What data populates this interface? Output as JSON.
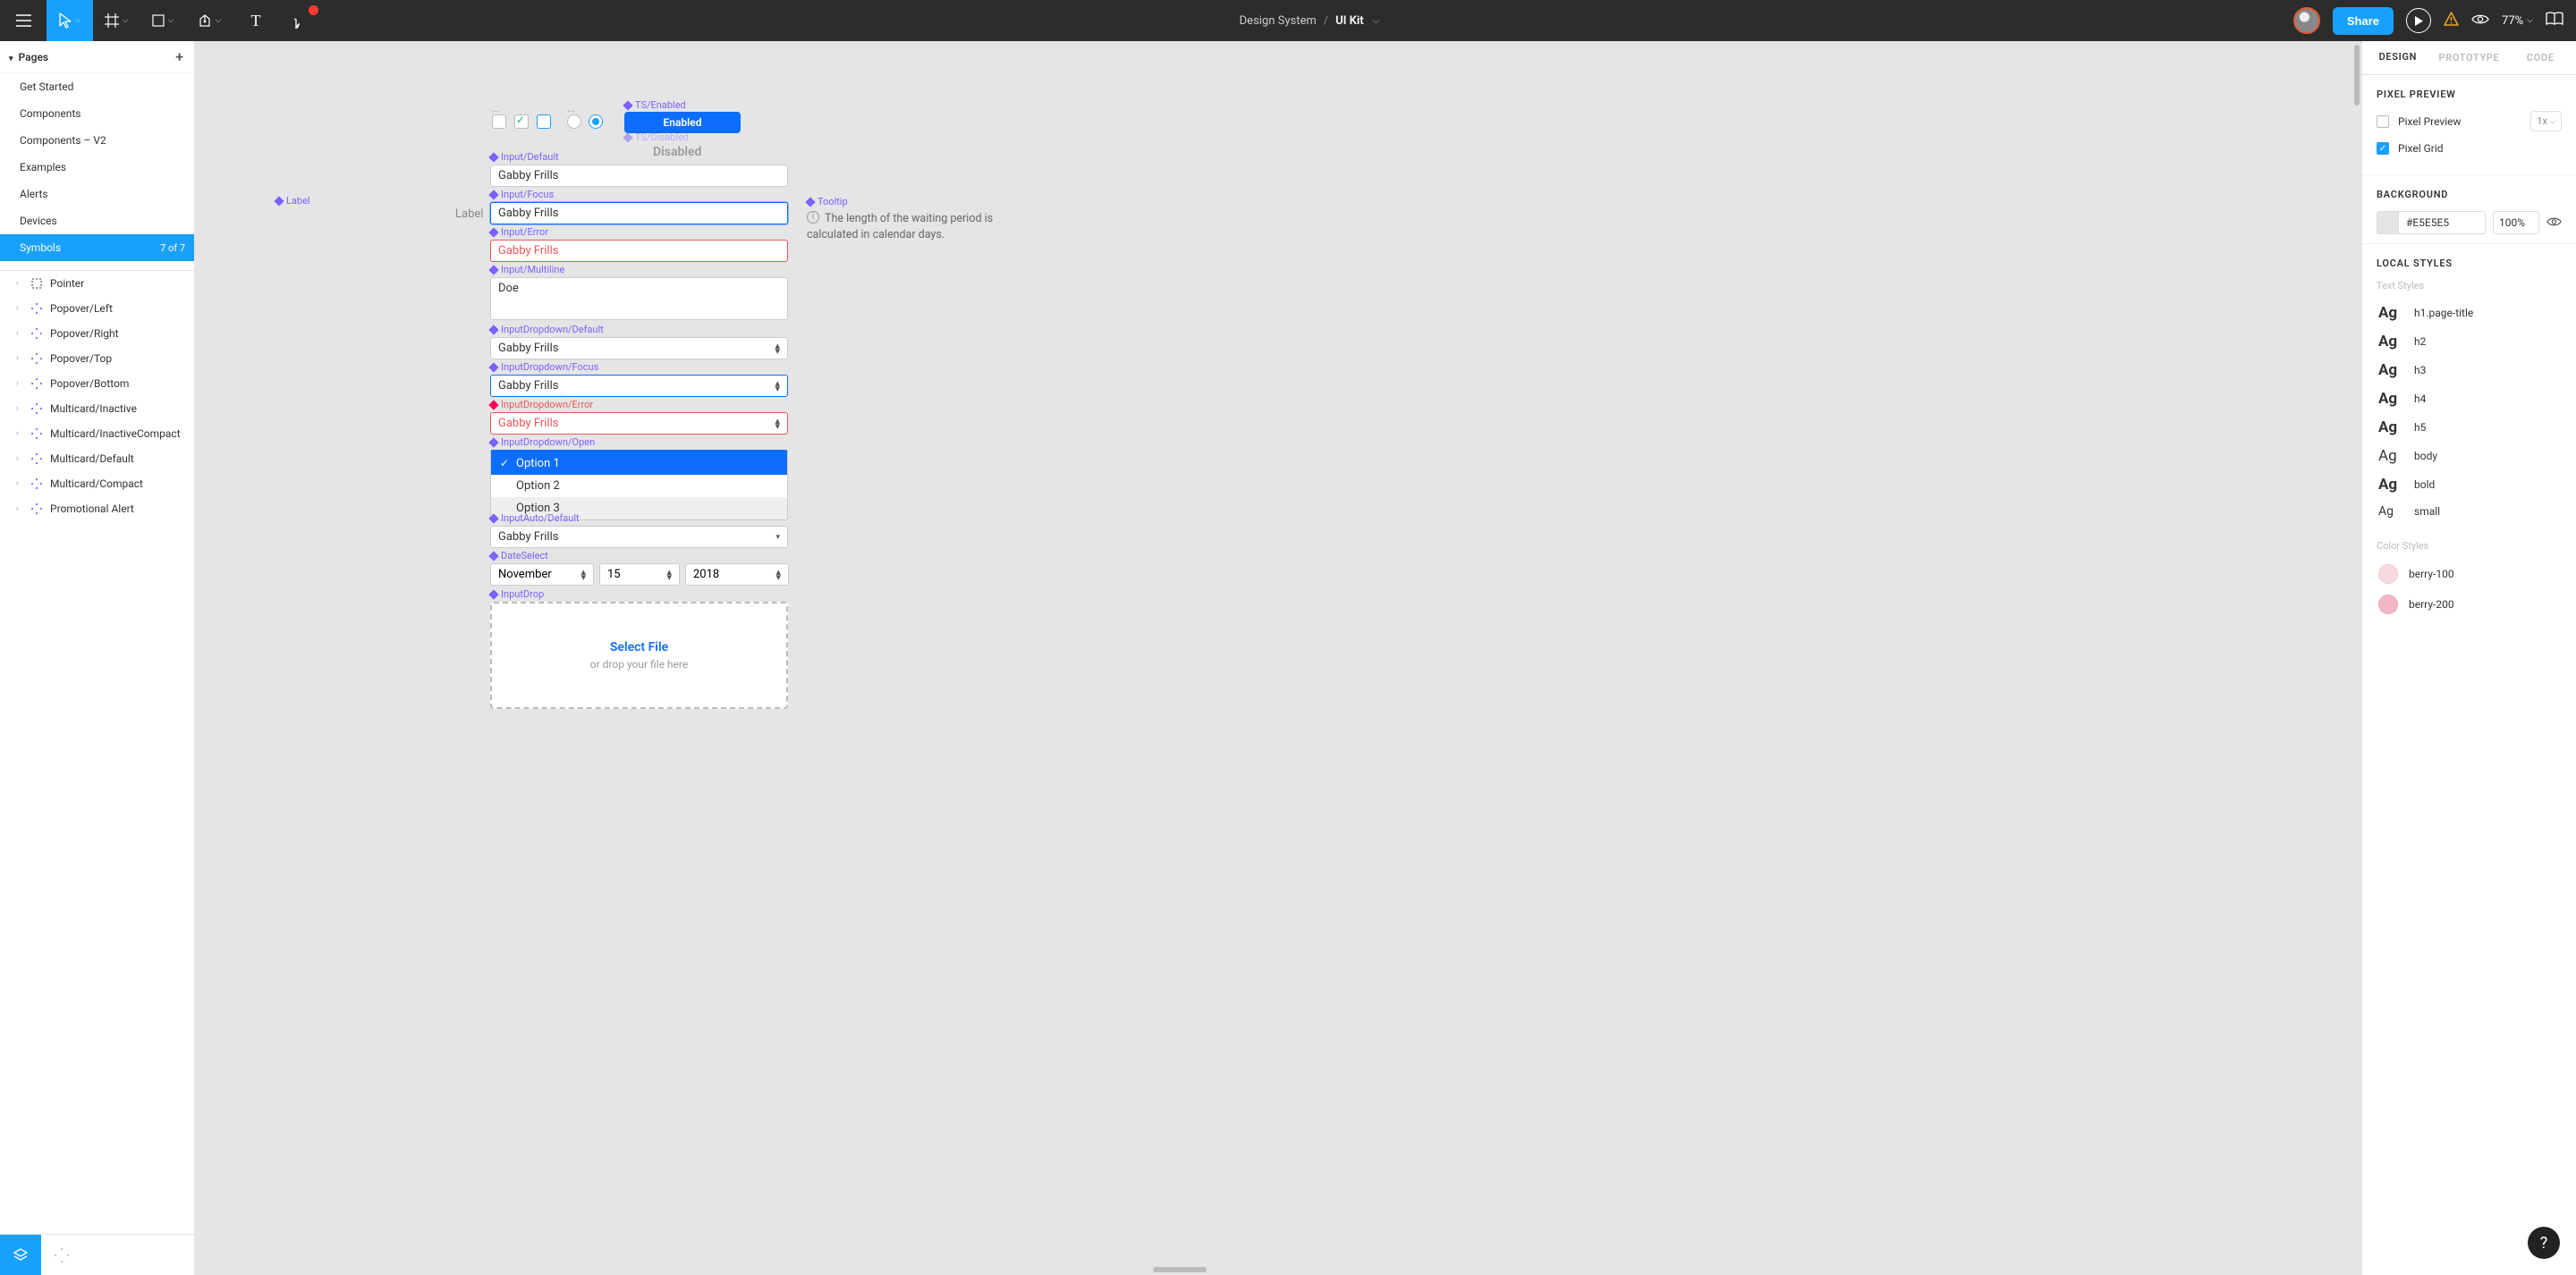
{
  "topbar": {
    "project_label": "Design System",
    "file_label": "UI Kit",
    "share_label": "Share",
    "zoom_label": "77%"
  },
  "left": {
    "pages_header": "Pages",
    "pages": [
      {
        "label": "Get Started"
      },
      {
        "label": "Components"
      },
      {
        "label": "Components – V2"
      },
      {
        "label": "Examples"
      },
      {
        "label": "Alerts"
      },
      {
        "label": "Devices"
      },
      {
        "label": "Symbols",
        "count": "7 of 7",
        "active": true
      }
    ],
    "layers": [
      {
        "label": "Pointer",
        "pointer": true
      },
      {
        "label": "Popover/Left"
      },
      {
        "label": "Popover/Right"
      },
      {
        "label": "Popover/Top"
      },
      {
        "label": "Popover/Bottom"
      },
      {
        "label": "Multicard/Inactive"
      },
      {
        "label": "Multicard/InactiveCompact"
      },
      {
        "label": "Multicard/Default"
      },
      {
        "label": "Multicard/Compact"
      },
      {
        "label": "Promotional Alert"
      }
    ]
  },
  "canvas": {
    "label_frame": "Label",
    "label_text": "Label",
    "ts_enabled": "TS/Enabled",
    "enabled_btn": "Enabled",
    "ts_disabled": "TS/Disabled",
    "disabled_btn": "Disabled",
    "input_default": "Input/Default",
    "input_focus": "Input/Focus",
    "input_error": "Input/Error",
    "input_multiline": "Input/Multiline",
    "dd_default": "InputDropdown/Default",
    "dd_focus": "InputDropdown/Focus",
    "dd_error": "InputDropdown/Error",
    "dd_open": "InputDropdown/Open",
    "auto_default": "InputAuto/Default",
    "date_select": "DateSelect",
    "input_drop": "InputDrop",
    "gabby": "Gabby Frills",
    "multiline_val": "Doe",
    "opt1": "Option 1",
    "opt2": "Option 2",
    "opt3": "Option 3",
    "month": "November",
    "day": "15",
    "year": "2018",
    "drop_title": "Select File",
    "drop_sub": "or drop your file here",
    "tooltip_label": "Tooltip",
    "tooltip_text": "The length of the waiting period is calculated in calendar days."
  },
  "right": {
    "tabs": {
      "design": "DESIGN",
      "prototype": "PROTOTYPE",
      "code": "CODE"
    },
    "pixel_preview_h": "PIXEL PREVIEW",
    "pixel_preview": "Pixel Preview",
    "pixel_grid": "Pixel Grid",
    "pp_scale": "1x",
    "background_h": "BACKGROUND",
    "bg_hex": "#E5E5E5",
    "bg_pct": "100%",
    "local_styles_h": "LOCAL STYLES",
    "text_styles_h": "Text Styles",
    "text_styles": [
      "h1.page-title",
      "h2",
      "h3",
      "h4",
      "h5",
      "body",
      "bold",
      "small"
    ],
    "color_styles_h": "Color Styles",
    "color_styles": [
      {
        "name": "berry-100",
        "hex": "#f8d9e0"
      },
      {
        "name": "berry-200",
        "hex": "#f3b7c5"
      }
    ]
  }
}
